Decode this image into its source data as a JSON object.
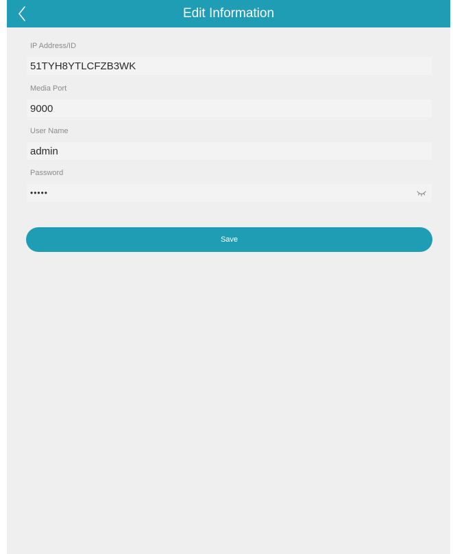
{
  "header": {
    "title": "Edit Information",
    "back_icon": "chevron-left-icon"
  },
  "form": {
    "ip_address": {
      "label": "IP Address/ID",
      "value": "51TYH8YTLCFZB3WK"
    },
    "media_port": {
      "label": "Media Port",
      "value": "9000"
    },
    "user_name": {
      "label": "User Name",
      "value": "admin"
    },
    "password": {
      "label": "Password",
      "value": "•••••",
      "toggle_icon": "eye-closed-icon"
    }
  },
  "actions": {
    "save_label": "Save"
  },
  "colors": {
    "accent": "#1f9db5",
    "background": "#efefef",
    "input_background": "#f3f3f3",
    "label": "#8a8a8a",
    "text": "#2a2a2a"
  }
}
